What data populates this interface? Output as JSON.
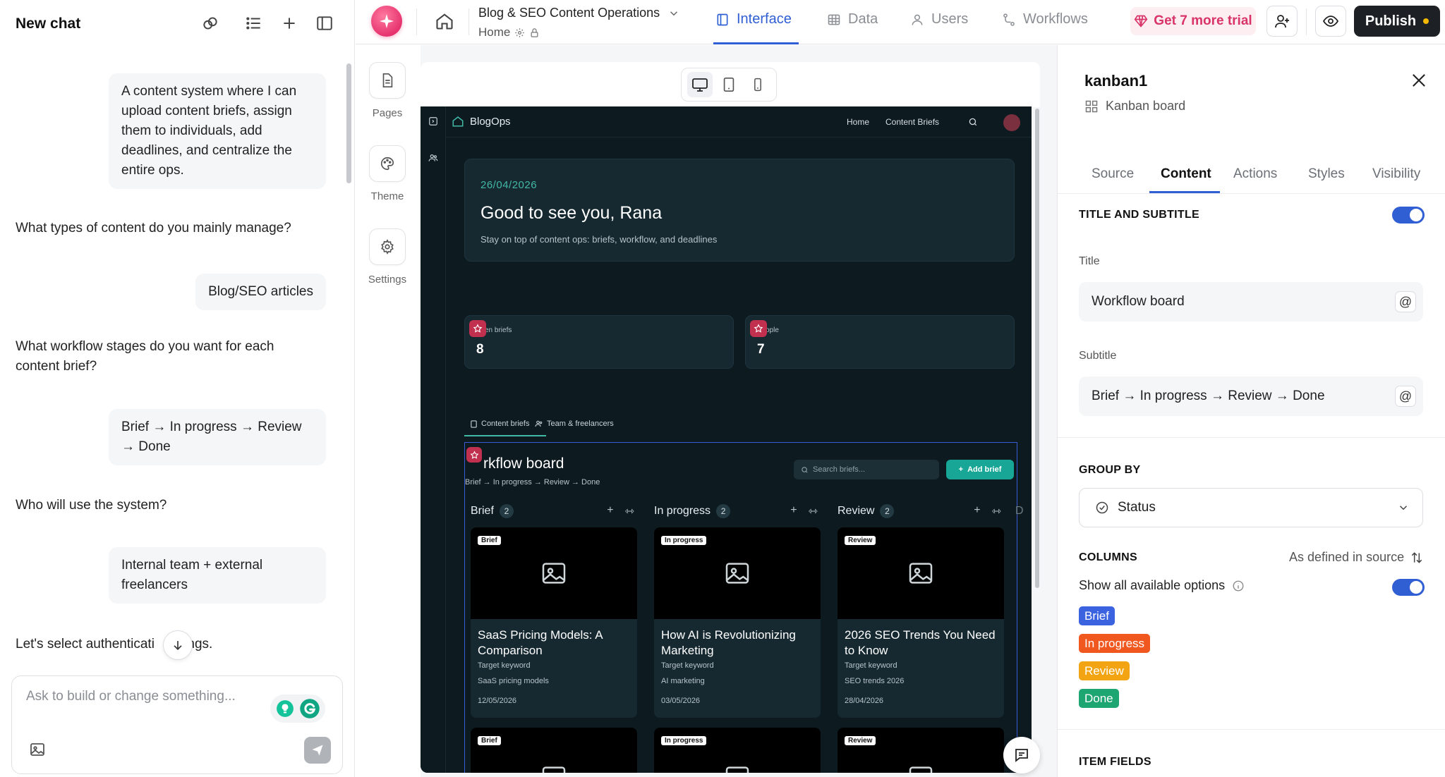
{
  "chat": {
    "title": "New chat",
    "messages": [
      {
        "role": "user",
        "text": "A content system where I can upload content briefs, assign them to individuals, add deadlines, and centralize the entire ops."
      },
      {
        "role": "assistant",
        "text": "What types of content do you mainly manage?"
      },
      {
        "role": "user",
        "text": "Blog/SEO articles"
      },
      {
        "role": "assistant",
        "text": "What workflow stages do you want for each content brief?"
      },
      {
        "role": "user",
        "text": "Brief → In progress → Review → Done"
      },
      {
        "role": "assistant",
        "text": "Who will use the system?"
      },
      {
        "role": "user",
        "text": "Internal team + external freelancers"
      },
      {
        "role": "assistant",
        "text": "Let's select authenticati    ettings."
      }
    ],
    "composer_placeholder": "Ask to build or change something..."
  },
  "topbar": {
    "project_title": "Blog & SEO Content Operations",
    "project_page": "Home",
    "tabs": [
      {
        "label": "Interface",
        "active": true
      },
      {
        "label": "Data",
        "active": false
      },
      {
        "label": "Users",
        "active": false
      },
      {
        "label": "Workflows",
        "active": false
      }
    ],
    "trial_label": "Get 7 more trial",
    "publish_label": "Publish"
  },
  "rail": {
    "items": [
      {
        "label": "Pages",
        "icon": "file-icon"
      },
      {
        "label": "Theme",
        "icon": "palette-icon"
      },
      {
        "label": "Settings",
        "icon": "gear-icon"
      }
    ]
  },
  "app": {
    "brand": "BlogOps",
    "nav": [
      "Home",
      "Content Briefs"
    ],
    "hero": {
      "date": "26/04/2026",
      "title": "Good to see you, Rana",
      "subtitle": "Stay on top of content ops: briefs, workflow, and deadlines"
    },
    "stats": [
      {
        "label": "en briefs",
        "value": "8"
      },
      {
        "label": "ople",
        "value": "7"
      }
    ],
    "tabs": [
      "Content briefs",
      "Team & freelancers"
    ],
    "kanban": {
      "title": "Workflow board",
      "title_visible": "rkflow board",
      "subtitle": "Brief → In progress → Review → Done",
      "search_placeholder": "Search briefs...",
      "add_label": "Add brief",
      "columns": [
        {
          "name": "Brief",
          "count": "2",
          "cards": [
            {
              "badge": "Brief",
              "title": "SaaS Pricing Models: A Comparison",
              "kw_label": "Target keyword",
              "keyword": "SaaS pricing models",
              "date": "12/05/2026"
            },
            {
              "badge": "Brief"
            }
          ]
        },
        {
          "name": "In progress",
          "count": "2",
          "cards": [
            {
              "badge": "In progress",
              "title": "How AI is Revolutionizing Marketing",
              "kw_label": "Target keyword",
              "keyword": "AI marketing",
              "date": "03/05/2026"
            },
            {
              "badge": "In progress"
            }
          ]
        },
        {
          "name": "Review",
          "count": "2",
          "cards": [
            {
              "badge": "Review",
              "title": "2026 SEO Trends You Need to Know",
              "kw_label": "Target keyword",
              "keyword": "SEO trends 2026",
              "date": "28/04/2026"
            },
            {
              "badge": "Review"
            }
          ]
        }
      ],
      "next_column_peek": "D"
    }
  },
  "props": {
    "component_name": "kanban1",
    "component_type": "Kanban board",
    "tabs": [
      "Source",
      "Content",
      "Actions",
      "Styles",
      "Visibility"
    ],
    "active_tab": "Content",
    "title_subtitle": {
      "heading": "TITLE AND SUBTITLE",
      "enabled": true,
      "title_label": "Title",
      "title_value": "Workflow board",
      "subtitle_label": "Subtitle",
      "subtitle_value": "Brief → In progress → Review → Done"
    },
    "group_by": {
      "heading": "GROUP BY",
      "value": "Status"
    },
    "columns": {
      "heading": "COLUMNS",
      "order_label": "As defined in source",
      "show_all_label": "Show all available options",
      "show_all_enabled": true,
      "chips": [
        {
          "label": "Brief",
          "color": "#3b63e0"
        },
        {
          "label": "In progress",
          "color": "#f0581f"
        },
        {
          "label": "Review",
          "color": "#f2a413"
        },
        {
          "label": "Done",
          "color": "#1ea672"
        }
      ]
    },
    "item_fields_heading": "ITEM FIELDS"
  },
  "colors": {
    "accent": "#2f5fd3",
    "brand_pink": "#e6336f",
    "app_bg": "#0d1a20",
    "teal": "#18a796"
  }
}
